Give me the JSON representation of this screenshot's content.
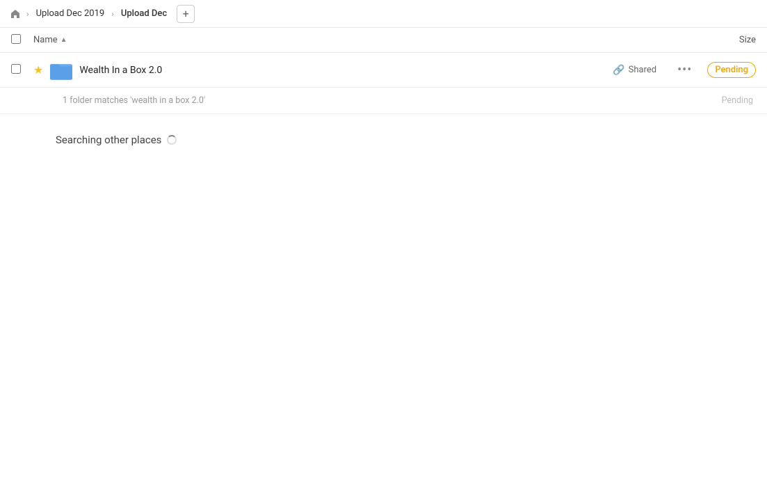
{
  "breadcrumb": {
    "home_icon": "🏠",
    "items": [
      {
        "label": "Upload Dec 2019",
        "active": false
      },
      {
        "label": "Upload Dec",
        "active": true
      }
    ],
    "add_button_label": "+"
  },
  "columns": {
    "name_label": "Name",
    "size_label": "Size",
    "sort_indicator": "▲"
  },
  "file_row": {
    "folder_name": "Wealth In a Box 2.0",
    "shared_label": "Shared",
    "more_label": "•••",
    "pending_label": "Pending",
    "folder_match_text": "1 folder matches 'wealth in a box 2.0'",
    "folder_match_status": "Pending"
  },
  "searching": {
    "title": "Searching other places"
  }
}
